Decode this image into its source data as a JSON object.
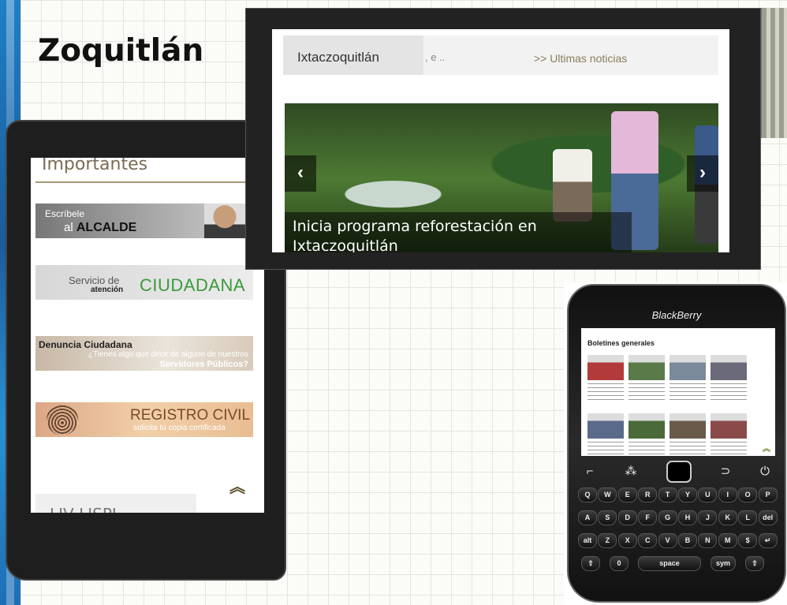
{
  "slide": {
    "title": "Zoquitlán"
  },
  "phone1": {
    "section_title": "Importantes",
    "banner_alcalde": {
      "line1": "Escríbele",
      "line2_prefix": "al",
      "line2_bold": "ALCALDE"
    },
    "banner_servicio": {
      "line1": "Servicio de",
      "line2": "atención",
      "big": "CIUDADANA"
    },
    "banner_denuncia": {
      "title": "Denuncia Ciudadana",
      "q1": "¿Tienes algo que decir de alguno de nuestros",
      "q2": "Servidores Públicos?"
    },
    "banner_registro": {
      "title": "REGISTRO CIVIL",
      "subtitle": "solicita tu copia certificada"
    },
    "scroll_up_glyph": "︽",
    "next_section": "LIV LISPI"
  },
  "tablet": {
    "tab_active": "Ixtaczoquitlán",
    "tab_tail": ", e ..",
    "tab_link": ">> Ultimas noticias",
    "arrow_left": "‹",
    "arrow_right": "›",
    "caption": "Inicia programa reforestación en Ixtaczoquitlán"
  },
  "blackberry": {
    "brand": "BlackBerry",
    "screen_title": "Boletines generales",
    "scroll_up_glyph": "︽",
    "nav_keys": {
      "call": "⌐",
      "menu": "⁂",
      "back": "⊃",
      "end": "⏻"
    },
    "keyboard": [
      [
        "Q",
        "W",
        "E",
        "R",
        "T",
        "Y",
        "U",
        "I",
        "O",
        "P"
      ],
      [
        "A",
        "S",
        "D",
        "F",
        "G",
        "H",
        "J",
        "K",
        "L",
        "del"
      ],
      [
        "alt",
        "Z",
        "X",
        "C",
        "V",
        "B",
        "N",
        "M",
        "$",
        "↵"
      ],
      [
        "⇧",
        "0",
        "space",
        "sym",
        "⇧"
      ]
    ]
  }
}
